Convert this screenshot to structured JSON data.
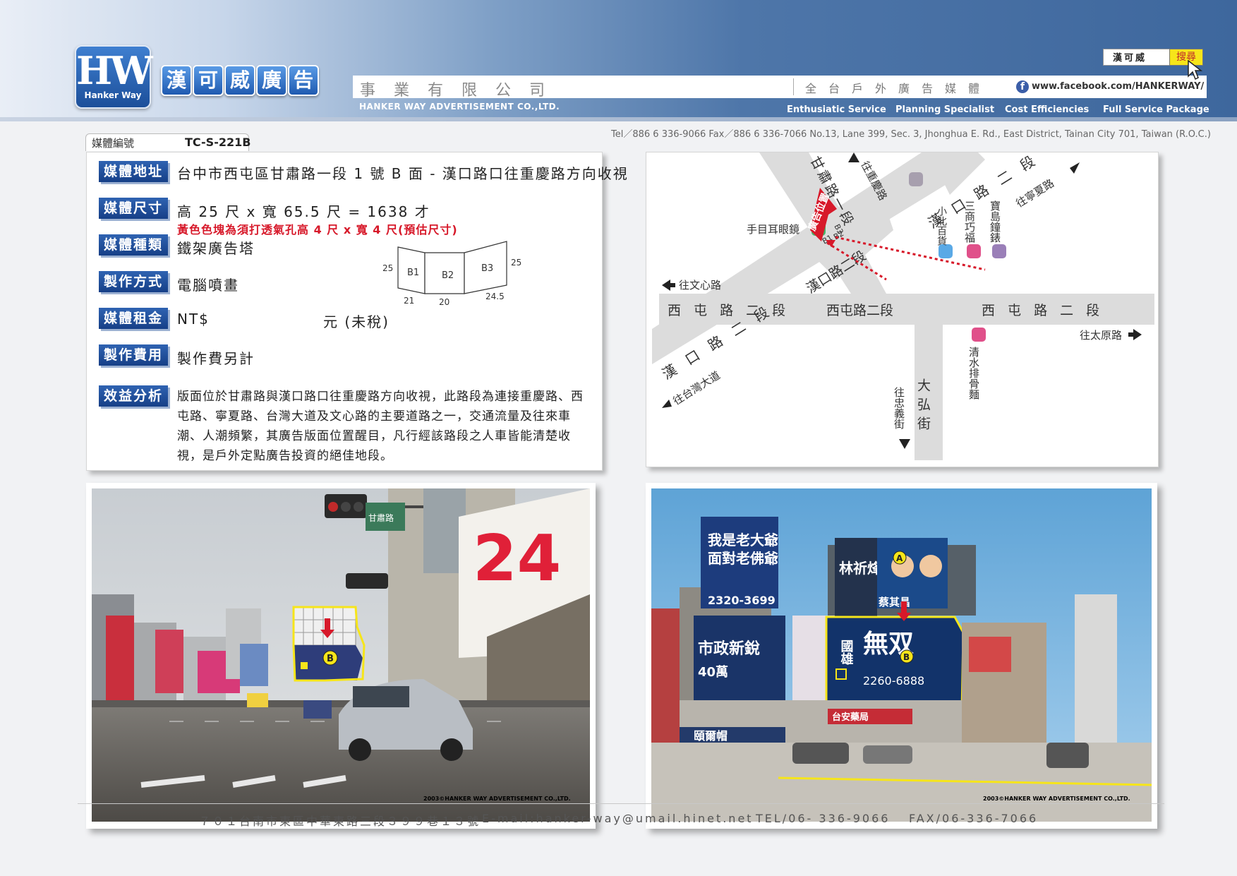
{
  "brand": {
    "logo_main": "HW",
    "logo_sub": "Hanker Way",
    "name_chars": [
      "漢",
      "可",
      "威",
      "廣",
      "告"
    ],
    "company_zh": "事業有限公司",
    "company_en": "HANKER WAY ADVERTISEMENT CO.,LTD.",
    "tagline_zh": "全台戶外廣告媒體",
    "facebook_url": "www.facebook.com/HANKERWAY/",
    "facebook_icon": "facebook-icon",
    "taglines_en": [
      "Enthusiatic Service",
      "Planning Specialist",
      "Cost Efficiencies",
      "Full Service Package"
    ],
    "contact": "Tel／886 6 336-9066   Fax／886 6 336-7066   No.13, Lane 399, Sec. 3, Jhonghua E. Rd., East District, Tainan City 701, Taiwan (R.O.C.)"
  },
  "search": {
    "query": "漢可威",
    "button": "搜尋"
  },
  "media": {
    "number_label": "媒體編號",
    "number": "TC-S-221B",
    "fields": [
      {
        "label": "媒體地址",
        "value": "台中市西屯區甘肅路一段 1 號 B 面 - 漢口路口往重慶路方向收視"
      },
      {
        "label": "媒體尺寸",
        "value": "高 25 尺 x 寬 65.5 尺 = 1638 才"
      },
      {
        "label": "媒體種類",
        "value": "鐵架廣告塔"
      },
      {
        "label": "製作方式",
        "value": "電腦噴畫"
      },
      {
        "label": "媒體租金",
        "value": "NT$"
      },
      {
        "label": "製作費用",
        "value": "製作費另計"
      },
      {
        "label": "效益分析",
        "value": "版面位於甘肅路與漢口路口往重慶路方向收視，此路段為連接重慶路、西屯路、寧夏路、台灣大道及文心路的主要道路之一，交通流量及往來車潮、人潮頻繁，其廣告版面位置醒目，凡行經該路段之人車皆能清楚收視，是戶外定點廣告投資的絕佳地段。"
      }
    ],
    "size_note": "黃色色塊為須打透氣孔高 4 尺 x 寬 4 尺(預估尺寸)",
    "rent_suffix": "元 (未稅)"
  },
  "diagram": {
    "faces": [
      "B1",
      "B2",
      "B3"
    ],
    "dims": [
      "25",
      "21",
      "20",
      "24.5",
      "25"
    ]
  },
  "map": {
    "roads": {
      "xitun_left": "西 屯 路 二 段",
      "xitun_mid": "西屯路二段",
      "xitun_right": "西 屯 路 二 段",
      "hankou_top": "漢 口 路 二 段",
      "hankou_mid": "漢口路二段",
      "hankou_low": "漢 口 路 二 段",
      "gansu": "甘肅路一段",
      "dahong": "大弘街"
    },
    "directions": {
      "wenxin": "往文心路",
      "taiwan": "往台灣大道",
      "chongqing": "往重慶路",
      "ningxia": "往寧夏路",
      "taiyuan": "往太原路",
      "zhongyi": "往忠義街"
    },
    "landmarks": {
      "eyeglasses": "手目耳眼鏡",
      "xiaobei": "小北百貨",
      "sanshang": "三商巧福",
      "baodao": "寶島鐘錶",
      "qingshui": "清水排骨麵"
    },
    "ad_tag": "廣告位置",
    "face_tags": [
      "B3",
      "B2",
      "B1"
    ]
  },
  "photos": {
    "credit": "2003©HANKER WAY ADVERTISEMENT CO.,LTD.",
    "left": {
      "marker": "B",
      "sign24": "24",
      "street_sign": "甘肅路"
    },
    "right": {
      "marker_a": "A",
      "marker_b": "B",
      "boards": [
        "我是老大爺",
        "面對老佛爺",
        "市政新銳",
        "林祈烽",
        "蔡其昌",
        "國雄",
        "無双",
        "2260-6888",
        "2320-3699",
        "40萬",
        "台安藥局",
        "頤爾帽"
      ]
    }
  },
  "footer": {
    "address": "７０１台南市東區中華東路三段３９９巷１３號",
    "email": "E-mail:hanker-way@umail.hinet.net",
    "tel": "TEL/06- 336-9066",
    "fax": "FAX/06-336-7066"
  },
  "colors": {
    "label_blue": "#1f4d9a",
    "alert_red": "#d7192a",
    "highlight_yellow": "#f6e51a",
    "header_blue": "#3e679d"
  }
}
